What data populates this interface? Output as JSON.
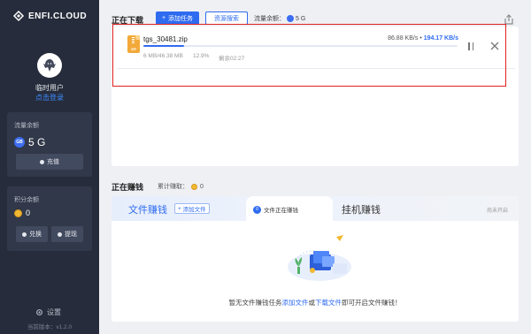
{
  "brand": {
    "name": "ENFI.CLOUD"
  },
  "user": {
    "name": "临时用户",
    "login_link": "点击登录"
  },
  "traffic_panel": {
    "title": "流量余额",
    "badge": "GB",
    "value": "5 G",
    "recharge_button": "充值"
  },
  "points_panel": {
    "title": "积分余额",
    "value": "0",
    "exchange_button": "兑换",
    "withdraw_button": "提现"
  },
  "settings": {
    "label": "设置"
  },
  "version": "当前版本：v1.2.0",
  "downloading": {
    "title": "正在下载",
    "add_task_button": "添加任务",
    "search_button": "资源搜索",
    "flow_label": "流量余额：",
    "flow_value": "5 G",
    "item": {
      "file_name": "tgs_30481.zip",
      "file_type": "ZIP",
      "speed_down": "86.88 KB/s",
      "speed_sep": "•",
      "speed_up": "194.17 KB/s",
      "size": "6 MB/46.38 MB",
      "percent": "12.9%",
      "progress": 0.129,
      "remaining": "剩余02:27"
    }
  },
  "earning": {
    "title": "正在赚钱",
    "total_label": "累计赚取：",
    "total_value": "0",
    "tab_file": "文件赚钱",
    "tab_add": "添加文件",
    "tab_status_count": "0",
    "tab_status_label": "文件正在赚钱",
    "tab_hang": "挂机赚钱",
    "tab_hint": "尚未开启",
    "empty_prefix": "暂无文件赚钱任务",
    "empty_link1": "添加文件",
    "empty_or": "或",
    "empty_link2": "下载文件",
    "empty_suffix": "即可开启文件赚钱！"
  },
  "colors": {
    "accent": "#2e6bf0",
    "sidebar": "#262c3b",
    "highlight_box": "#e02020"
  }
}
